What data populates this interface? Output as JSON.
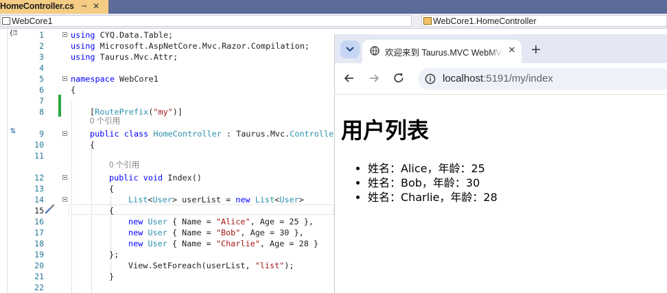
{
  "editor": {
    "tab": {
      "title": "HomeController.cs",
      "pin_glyph": "⊸",
      "close_glyph": "✕"
    },
    "navbar": {
      "project_combo": "WebCore1",
      "class_combo": "WebCore1.HomeController"
    },
    "lens": {
      "references_0": "0 个引用"
    },
    "lines": [
      {
        "n": "1",
        "code": "using CYQ.Data.Table;"
      },
      {
        "n": "2",
        "code": "using Microsoft.AspNetCore.Mvc.Razor.Compilation;"
      },
      {
        "n": "3",
        "code": "using Taurus.Mvc.Attr;"
      },
      {
        "n": "4",
        "code": ""
      },
      {
        "n": "5",
        "code": "namespace WebCore1"
      },
      {
        "n": "6",
        "code": "{"
      },
      {
        "n": "7",
        "code": ""
      },
      {
        "n": "8",
        "code": "[RoutePrefix(\"my\")]"
      },
      {
        "n": "9",
        "code": "public class HomeController : Taurus.Mvc.Controller"
      },
      {
        "n": "10",
        "code": "{"
      },
      {
        "n": "11",
        "code": ""
      },
      {
        "n": "12",
        "code": "public void Index()"
      },
      {
        "n": "13",
        "code": "{"
      },
      {
        "n": "14",
        "code": "List<User> userList = new List<User>"
      },
      {
        "n": "15",
        "code": "{"
      },
      {
        "n": "16",
        "code": "new User { Name = \"Alice\", Age = 25 },"
      },
      {
        "n": "17",
        "code": "new User { Name = \"Bob\", Age = 30 },"
      },
      {
        "n": "18",
        "code": "new User { Name = \"Charlie\", Age = 28 }"
      },
      {
        "n": "19",
        "code": "};"
      },
      {
        "n": "20",
        "code": "View.SetForeach(userList, \"list\");"
      },
      {
        "n": "21",
        "code": "}"
      },
      {
        "n": "22",
        "code": ""
      }
    ],
    "tokens": {
      "using": "using",
      "namespace": "namespace",
      "public": "public",
      "class": "class",
      "void": "void",
      "new": "new",
      "RoutePrefix": "RoutePrefix",
      "my_str": "\"my\"",
      "HomeController": "HomeController",
      "Controller": "Controller",
      "List": "List",
      "User": "User",
      "Alice": "\"Alice\"",
      "Bob": "\"Bob\"",
      "Charlie": "\"Charlie\"",
      "list_str": "\"list\""
    }
  },
  "browser": {
    "tab_title": "欢迎来到 Taurus.MVC WebMVC",
    "tab_close": "✕",
    "new_tab": "+",
    "url_host": "localhost",
    "url_rest": ":5191/my/index",
    "page": {
      "heading": "用户列表",
      "items": [
        "姓名：Alice，年龄：25",
        "姓名：Bob，年龄：30",
        "姓名：Charlie，年龄：28"
      ]
    }
  },
  "colors": {
    "keyword": "#0000ff",
    "type": "#2b91af",
    "string": "#a31515",
    "line_number": "#237893",
    "tab_active": "#f5cc84",
    "vs_tabstrip": "#5d6b99",
    "change_bar": "#28a745"
  },
  "icons": [
    "pin-icon",
    "close-icon",
    "namespace-icon",
    "class-icon",
    "fold-icon",
    "quick-action-brush-icon",
    "implementation-icon",
    "tab-search-icon",
    "globe-icon",
    "back-icon",
    "forward-icon",
    "reload-icon",
    "site-info-icon"
  ]
}
